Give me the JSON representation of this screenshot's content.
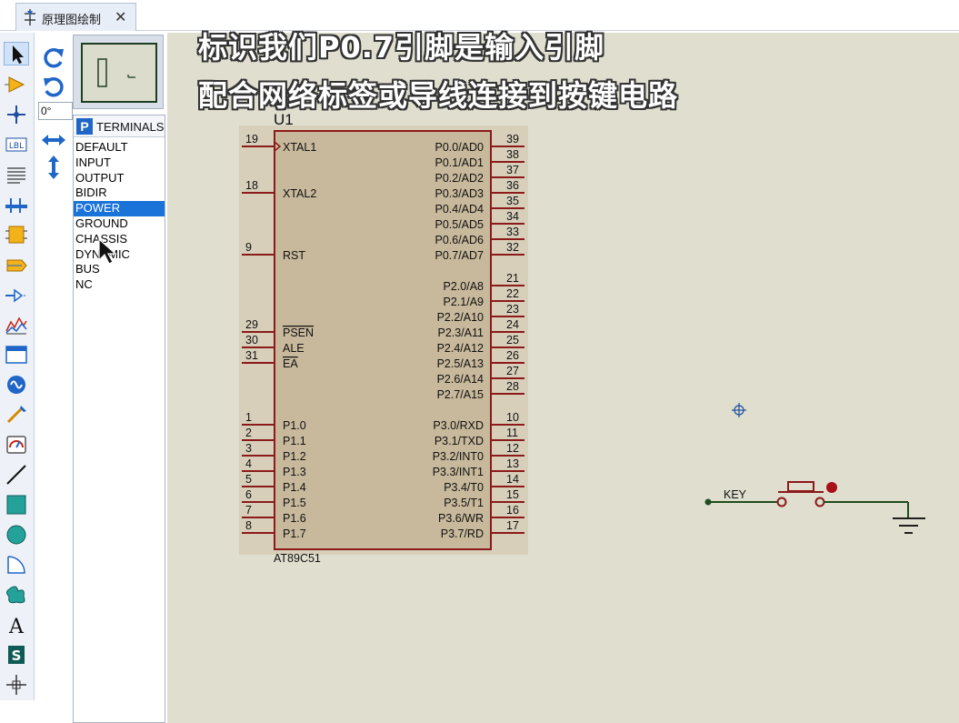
{
  "tab": {
    "label": "原理图绘制",
    "close": "✕"
  },
  "angle": {
    "value": "0°"
  },
  "picker": {
    "mode_button": "P",
    "title": "TERMINALS",
    "items": [
      "DEFAULT",
      "INPUT",
      "OUTPUT",
      "BIDIR",
      "POWER",
      "GROUND",
      "CHASSIS",
      "DYNAMIC",
      "BUS",
      "NC"
    ],
    "selected": "POWER"
  },
  "caption": {
    "line1": "标识我们P0.7引脚是输入引脚",
    "line2": "配合网络标签或导线连接到按键电路"
  },
  "chip": {
    "ref": "U1",
    "part": "AT89C51",
    "left_pins": [
      {
        "num": "19",
        "name": "XTAL1"
      },
      {
        "num": "18",
        "name": "XTAL2"
      },
      {
        "num": "9",
        "name": "RST"
      },
      {
        "num": "29",
        "name": "PSEN"
      },
      {
        "num": "30",
        "name": "ALE"
      },
      {
        "num": "31",
        "name": "EA"
      },
      {
        "num": "1",
        "name": "P1.0"
      },
      {
        "num": "2",
        "name": "P1.1"
      },
      {
        "num": "3",
        "name": "P1.2"
      },
      {
        "num": "4",
        "name": "P1.3"
      },
      {
        "num": "5",
        "name": "P1.4"
      },
      {
        "num": "6",
        "name": "P1.5"
      },
      {
        "num": "7",
        "name": "P1.6"
      },
      {
        "num": "8",
        "name": "P1.7"
      }
    ],
    "right_pins": [
      {
        "num": "39",
        "name": "P0.0/AD0"
      },
      {
        "num": "38",
        "name": "P0.1/AD1"
      },
      {
        "num": "37",
        "name": "P0.2/AD2"
      },
      {
        "num": "36",
        "name": "P0.3/AD3"
      },
      {
        "num": "35",
        "name": "P0.4/AD4"
      },
      {
        "num": "34",
        "name": "P0.5/AD5"
      },
      {
        "num": "33",
        "name": "P0.6/AD6"
      },
      {
        "num": "32",
        "name": "P0.7/AD7"
      },
      {
        "num": "21",
        "name": "P2.0/A8"
      },
      {
        "num": "22",
        "name": "P2.1/A9"
      },
      {
        "num": "23",
        "name": "P2.2/A10"
      },
      {
        "num": "24",
        "name": "P2.3/A11"
      },
      {
        "num": "25",
        "name": "P2.4/A12"
      },
      {
        "num": "26",
        "name": "P2.5/A13"
      },
      {
        "num": "27",
        "name": "P2.6/A14"
      },
      {
        "num": "28",
        "name": "P2.7/A15"
      },
      {
        "num": "10",
        "name": "P3.0/RXD"
      },
      {
        "num": "11",
        "name": "P3.1/TXD"
      },
      {
        "num": "12",
        "name": "P3.2/INT0"
      },
      {
        "num": "13",
        "name": "P3.3/INT1"
      },
      {
        "num": "14",
        "name": "P3.4/T0"
      },
      {
        "num": "15",
        "name": "P3.5/T1"
      },
      {
        "num": "16",
        "name": "P3.6/WR"
      },
      {
        "num": "17",
        "name": "P3.7/RD"
      }
    ]
  },
  "net_label": {
    "text": "KEY"
  },
  "colors": {
    "canvas": "#dfdecf",
    "chip_body": "#c8b99c",
    "chip_outline": "#8b1a1a",
    "wire": "#1e4d1e",
    "selection": "#1a73d8"
  },
  "icons": {
    "toolbar": [
      "selection-arrow-icon",
      "component-icon",
      "junction-icon",
      "wire-label-icon",
      "text-script-icon",
      "bus-icon",
      "subcircuit-icon",
      "terminal-icon",
      "device-pin-icon",
      "graph-icon",
      "tape-recorder-icon",
      "generator-icon",
      "voltage-probe-icon",
      "virtual-instrument-icon",
      "line-icon",
      "box-icon",
      "circle-icon",
      "arc-icon",
      "path-icon",
      "text-icon",
      "symbol-icon",
      "marker-icon"
    ],
    "rotation": [
      "rotate-clockwise-icon",
      "rotate-anticlockwise-icon",
      "flip-horizontal-icon",
      "flip-vertical-icon"
    ]
  }
}
